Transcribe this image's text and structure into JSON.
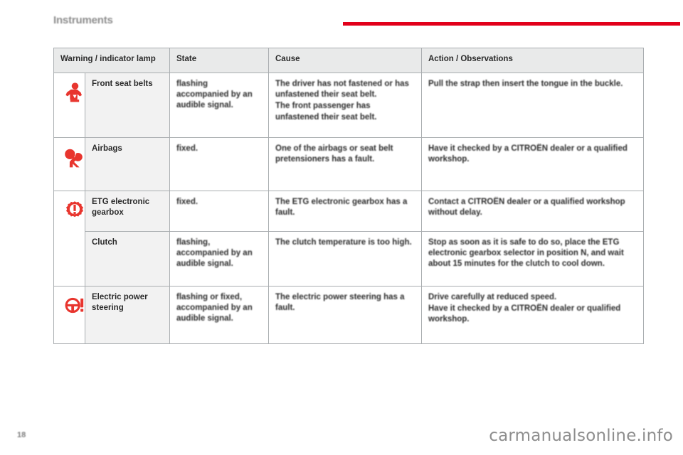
{
  "header": {
    "title": "Instruments",
    "accent_color": "#e2001a"
  },
  "table": {
    "columns": [
      {
        "key": "icon",
        "label": ""
      },
      {
        "key": "lamp",
        "label": "Warning / indicator lamp"
      },
      {
        "key": "state",
        "label": "State"
      },
      {
        "key": "cause",
        "label": "Cause"
      },
      {
        "key": "action",
        "label": "Action / Observations"
      }
    ],
    "rows": [
      {
        "icon": "seat-belt-icon",
        "lamp": "Front seat belts",
        "state": "flashing accompanied by an audible signal.",
        "cause_lines": [
          "The driver has not fastened or has unfastened their seat belt.",
          "The front passenger has unfastened their seat belt."
        ],
        "action_lines": [
          "Pull the strap then insert the tongue in the buckle."
        ]
      },
      {
        "icon": "airbag-icon",
        "lamp": "Airbags",
        "state": "fixed.",
        "cause_lines": [
          "One of the airbags or seat belt pretensioners has a fault."
        ],
        "action_lines": [
          "Have it checked by a CITROËN dealer or a qualified workshop."
        ]
      },
      {
        "icon": "gearbox-fault-icon",
        "lamp": "ETG electronic gearbox",
        "state": "fixed.",
        "cause_lines": [
          "The ETG electronic gearbox has a fault."
        ],
        "action_lines": [
          "Contact a CITROËN dealer or a qualified workshop without delay."
        ]
      },
      {
        "icon": "",
        "lamp": "Clutch",
        "state": "flashing, accompanied by an audible signal.",
        "cause_lines": [
          "The clutch temperature is too high."
        ],
        "action_lines": [
          "Stop as soon as it is safe to do so, place the ETG electronic gearbox selector in position N, and wait about 15 minutes for the clutch to cool down."
        ]
      },
      {
        "icon": "steering-fault-icon",
        "lamp": "Electric power steering",
        "state": "flashing or fixed, accompanied by an audible signal.",
        "cause_lines": [
          "The electric power steering has a fault."
        ],
        "action_lines": [
          "Drive carefully at reduced speed.",
          "Have it checked by a CITROËN dealer or qualified workshop."
        ]
      }
    ]
  },
  "footer": {
    "page_number": "18",
    "watermark": "carmanualsonline.info"
  },
  "colors": {
    "lamp_red": "#e8352e",
    "header_rule": "#e2001a",
    "table_header_bg": "#e9eaea",
    "lamp_cell_bg": "#f2f2f2",
    "border": "#a9adb0"
  }
}
